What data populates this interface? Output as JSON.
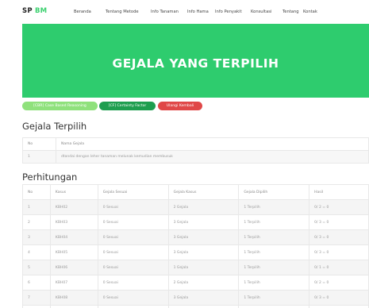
{
  "nav": {
    "brand_part1": "SP",
    "brand_part2": "BM",
    "items": [
      "Beranda",
      "Tentang Metode",
      "Info Tanaman",
      "Info Hama",
      "Info Penyakit",
      "Konsultasi",
      "Tentang",
      "Kontak"
    ]
  },
  "banner": {
    "title": "GEJALA YANG TERPILIH"
  },
  "buttons": {
    "cbr": "[CBR] Case Based Reasoning",
    "cf": "[CF] Certainty Factor",
    "reset": "Ulangi Kembali"
  },
  "gejala_terpilih": {
    "title": "Gejala Terpilih",
    "headers": [
      "No",
      "Nama Gejala"
    ],
    "rows": [
      [
        "1",
        "dtandai dengan leher tanaman melunak kemudian membusuk"
      ]
    ]
  },
  "perhitungan": {
    "title": "Perhitungan",
    "headers": [
      "No",
      "Kasus",
      "Gejala Sesuai",
      "Gejala Kasus",
      "Gejala Dipilih",
      "Hasil"
    ],
    "rows": [
      [
        "1",
        "KBH02",
        "0 Sesuai",
        "2 Gejala",
        "1 Terpilih",
        "0/ 2 = 0"
      ],
      [
        "2",
        "KBH03",
        "0 Sesuai",
        "3 Gejala",
        "1 Terpilih",
        "0/ 3 = 0"
      ],
      [
        "3",
        "KBH04",
        "0 Sesuai",
        "3 Gejala",
        "1 Terpilih",
        "0/ 3 = 0"
      ],
      [
        "4",
        "KBH05",
        "0 Sesuai",
        "3 Gejala",
        "1 Terpilih",
        "0/ 3 = 0"
      ],
      [
        "5",
        "KBH06",
        "0 Sesuai",
        "1 Gejala",
        "1 Terpilih",
        "0/ 1 = 0"
      ],
      [
        "6",
        "KBH07",
        "0 Sesuai",
        "2 Gejala",
        "1 Terpilih",
        "0/ 2 = 0"
      ],
      [
        "7",
        "KBH08",
        "0 Sesuai",
        "3 Gejala",
        "1 Terpilih",
        "0/ 3 = 0"
      ],
      [
        "8",
        "KBH09",
        "0 Sesuai",
        "3 Gejala",
        "1 Terpilih",
        "0/ 3 = 0"
      ]
    ]
  }
}
